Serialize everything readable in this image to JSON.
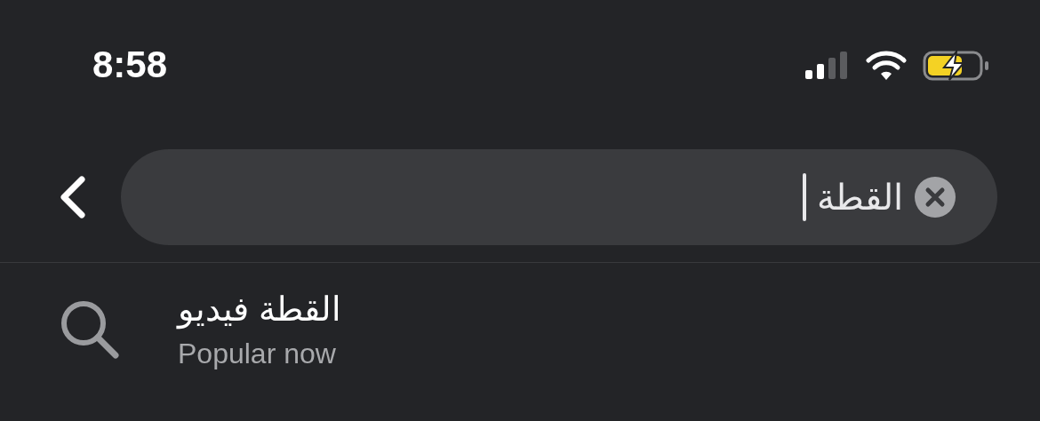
{
  "status_bar": {
    "time": "8:58"
  },
  "search": {
    "value": "القطة"
  },
  "suggestions": [
    {
      "title": "القطة فيديو",
      "subtitle": "Popular now"
    }
  ]
}
